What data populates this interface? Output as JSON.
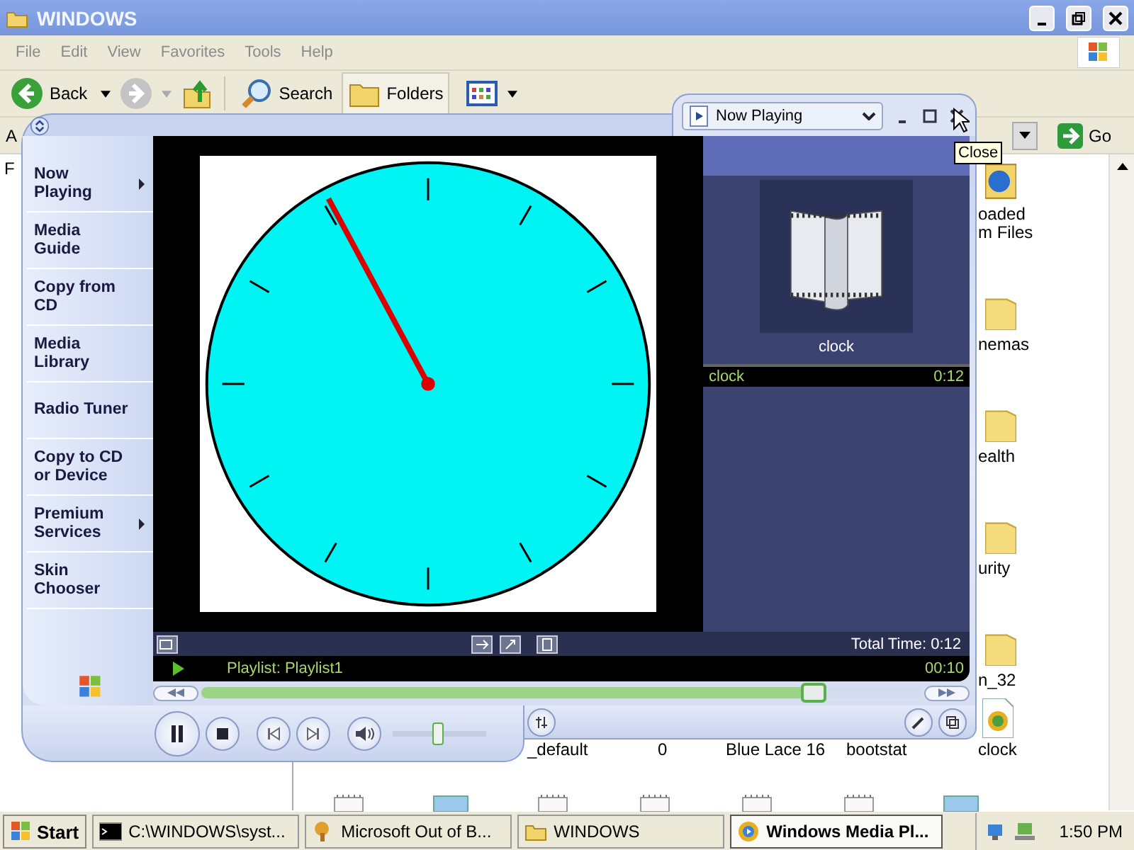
{
  "explorer": {
    "title": "WINDOWS",
    "menu": [
      "File",
      "Edit",
      "View",
      "Favorites",
      "Tools",
      "Help"
    ],
    "toolbar": {
      "back": "Back",
      "search": "Search",
      "folders": "Folders"
    },
    "address_label": "A",
    "go": "Go",
    "tree_label": "F",
    "files": [
      {
        "lines": [
          "oaded",
          "m Files"
        ],
        "kind": "app"
      },
      {
        "lines": [
          "nemas"
        ],
        "kind": "folder"
      },
      {
        "lines": [
          "ealth"
        ],
        "kind": "folder"
      },
      {
        "lines": [
          "urity"
        ],
        "kind": "folder"
      },
      {
        "lines": [
          "n_32"
        ],
        "kind": "folder"
      }
    ],
    "bottom_labels": [
      {
        "label": "_default",
        "kind": "none"
      },
      {
        "label": "0",
        "kind": "none"
      },
      {
        "label": "Blue Lace 16",
        "kind": "none"
      },
      {
        "label": "bootstat",
        "kind": "none"
      },
      {
        "label": "clock",
        "kind": "media"
      }
    ],
    "partial_icons": [
      {
        "kind": "doc"
      },
      {
        "kind": "image"
      },
      {
        "kind": "doc"
      },
      {
        "kind": "doc"
      },
      {
        "kind": "doc"
      },
      {
        "kind": "doc"
      },
      {
        "kind": "image"
      }
    ]
  },
  "player": {
    "view": "Now Playing",
    "tooltip": "Close",
    "nav": [
      {
        "label": "Now Playing",
        "submenu": true
      },
      {
        "label": "Media Guide",
        "submenu": false
      },
      {
        "label": "Copy from CD",
        "submenu": false
      },
      {
        "label": "Media Library",
        "submenu": false
      },
      {
        "label": "Radio Tuner",
        "submenu": false
      },
      {
        "label": "Copy to CD or Device",
        "submenu": false
      },
      {
        "label": "Premium Services",
        "submenu": true
      },
      {
        "label": "Skin Chooser",
        "submenu": false
      }
    ],
    "media_title": "clock",
    "playlist": [
      {
        "title": "clock",
        "duration": "0:12",
        "selected": true
      }
    ],
    "total_time": "Total Time: 0:12",
    "status": "Playlist: Playlist1",
    "elapsed": "00:10",
    "playing": true,
    "seek": {
      "level": 0.85
    },
    "volume": {
      "level": 0.48
    }
  },
  "taskbar": {
    "start": "Start",
    "tasks": [
      {
        "label": "C:\\WINDOWS\\syst...",
        "kind": "console",
        "selected": false
      },
      {
        "label": "Microsoft Out of B...",
        "kind": "wizard",
        "selected": false
      },
      {
        "label": "WINDOWS",
        "kind": "folder",
        "selected": false
      },
      {
        "label": "Windows Media Pl...",
        "kind": "media",
        "selected": true
      }
    ],
    "time": "1:50 PM"
  }
}
